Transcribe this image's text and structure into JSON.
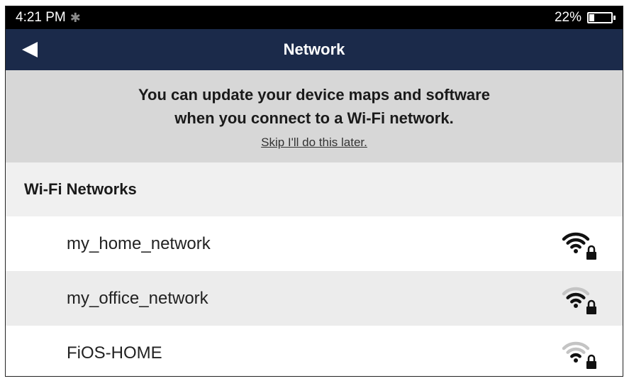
{
  "status_bar": {
    "time": "4:21 PM",
    "bluetooth_icon": "bluetooth-icon",
    "battery_label": "22%",
    "battery_level": 0.22
  },
  "nav": {
    "title": "Network",
    "back_icon": "back-arrow-icon"
  },
  "banner": {
    "line1": "You can update your device maps and software",
    "line2": "when you connect to a Wi-Fi network.",
    "skip_label": "Skip I'll do this later."
  },
  "wifi_section": {
    "title": "Wi-Fi Networks",
    "networks": [
      {
        "name": "my_home_network",
        "signal_bars": 3,
        "secured": true
      },
      {
        "name": "my_office_network",
        "signal_bars": 2,
        "secured": true
      },
      {
        "name": "FiOS-HOME",
        "signal_bars": 1,
        "secured": true
      }
    ]
  },
  "colors": {
    "nav_bg": "#1b2a4a",
    "banner_bg": "#d7d7d7",
    "signal_on": "#111111",
    "signal_off": "#c4c4c4"
  }
}
